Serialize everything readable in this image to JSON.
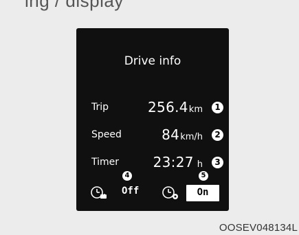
{
  "header_fragment": "ing / display",
  "panel": {
    "title": "Drive info",
    "rows": [
      {
        "label": "Trip",
        "value": "256.4",
        "unit": "km",
        "badge": "1"
      },
      {
        "label": "Speed",
        "value": "84",
        "unit": "km/h",
        "badge": "2"
      },
      {
        "label": "Timer",
        "value": "23:27",
        "unit": "h",
        "badge": "3"
      }
    ],
    "toggles": [
      {
        "icon": "clock-power-icon",
        "state": "Off",
        "badge": "4"
      },
      {
        "icon": "clock-gear-icon",
        "state": "On",
        "badge": "5"
      }
    ]
  },
  "caption": "OOSEV048134L"
}
